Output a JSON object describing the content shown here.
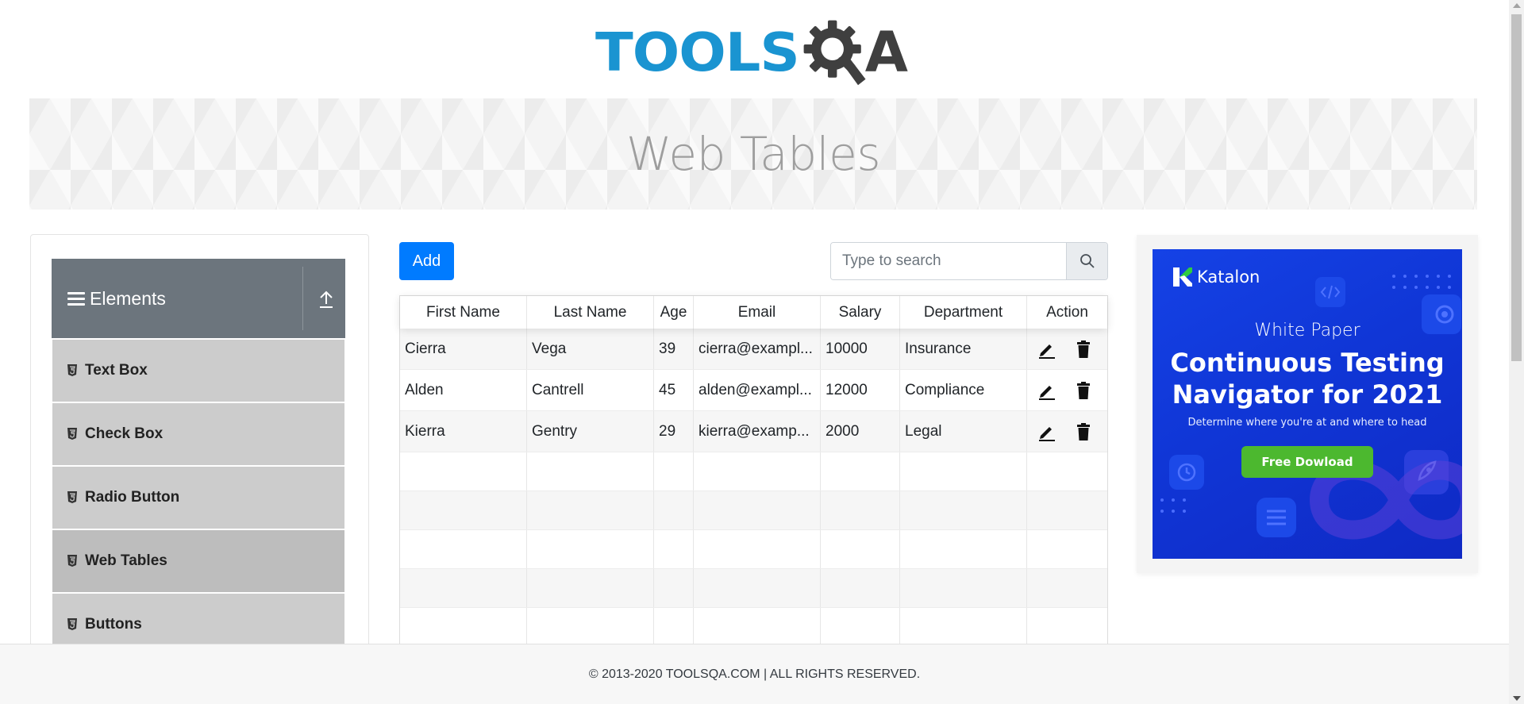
{
  "logo": {
    "part1": "TOOLS",
    "part2": "A"
  },
  "banner": {
    "title": "Web Tables"
  },
  "sidebar": {
    "group": {
      "title": "Elements",
      "icon": "hamburger-icon",
      "collapse_icon": "collapse-up-icon"
    },
    "items": [
      {
        "label": "Text Box"
      },
      {
        "label": "Check Box"
      },
      {
        "label": "Radio Button"
      },
      {
        "label": "Web Tables",
        "active": true
      },
      {
        "label": "Buttons"
      }
    ]
  },
  "toolbar": {
    "add_label": "Add"
  },
  "search": {
    "placeholder": "Type to search",
    "value": ""
  },
  "table": {
    "columns": [
      "First Name",
      "Last Name",
      "Age",
      "Email",
      "Salary",
      "Department",
      "Action"
    ],
    "rows": [
      {
        "first": "Cierra",
        "last": "Vega",
        "age": "39",
        "email": "cierra@exampl...",
        "salary": "10000",
        "department": "Insurance"
      },
      {
        "first": "Alden",
        "last": "Cantrell",
        "age": "45",
        "email": "alden@exampl...",
        "salary": "12000",
        "department": "Compliance"
      },
      {
        "first": "Kierra",
        "last": "Gentry",
        "age": "29",
        "email": "kierra@examp...",
        "salary": "2000",
        "department": "Legal"
      }
    ],
    "action_icons": [
      "edit-icon",
      "delete-icon"
    ]
  },
  "ad": {
    "brand": "Katalon",
    "eyebrow": "White Paper",
    "headline_line1": "Continuous Testing",
    "headline_line2": "Navigator for 2021",
    "subtext": "Determine where you're at and where to head",
    "cta": "Free Dowload",
    "colors": {
      "background": "#1138d8",
      "cta": "#4cb82f"
    }
  },
  "footer": {
    "text": "© 2013-2020 TOOLSQA.COM | ALL RIGHTS RESERVED."
  },
  "colors": {
    "primary": "#007bff",
    "brand_blue": "#1a94d1",
    "menu_header": "#6c757d",
    "menu_item": "#cccccc"
  }
}
